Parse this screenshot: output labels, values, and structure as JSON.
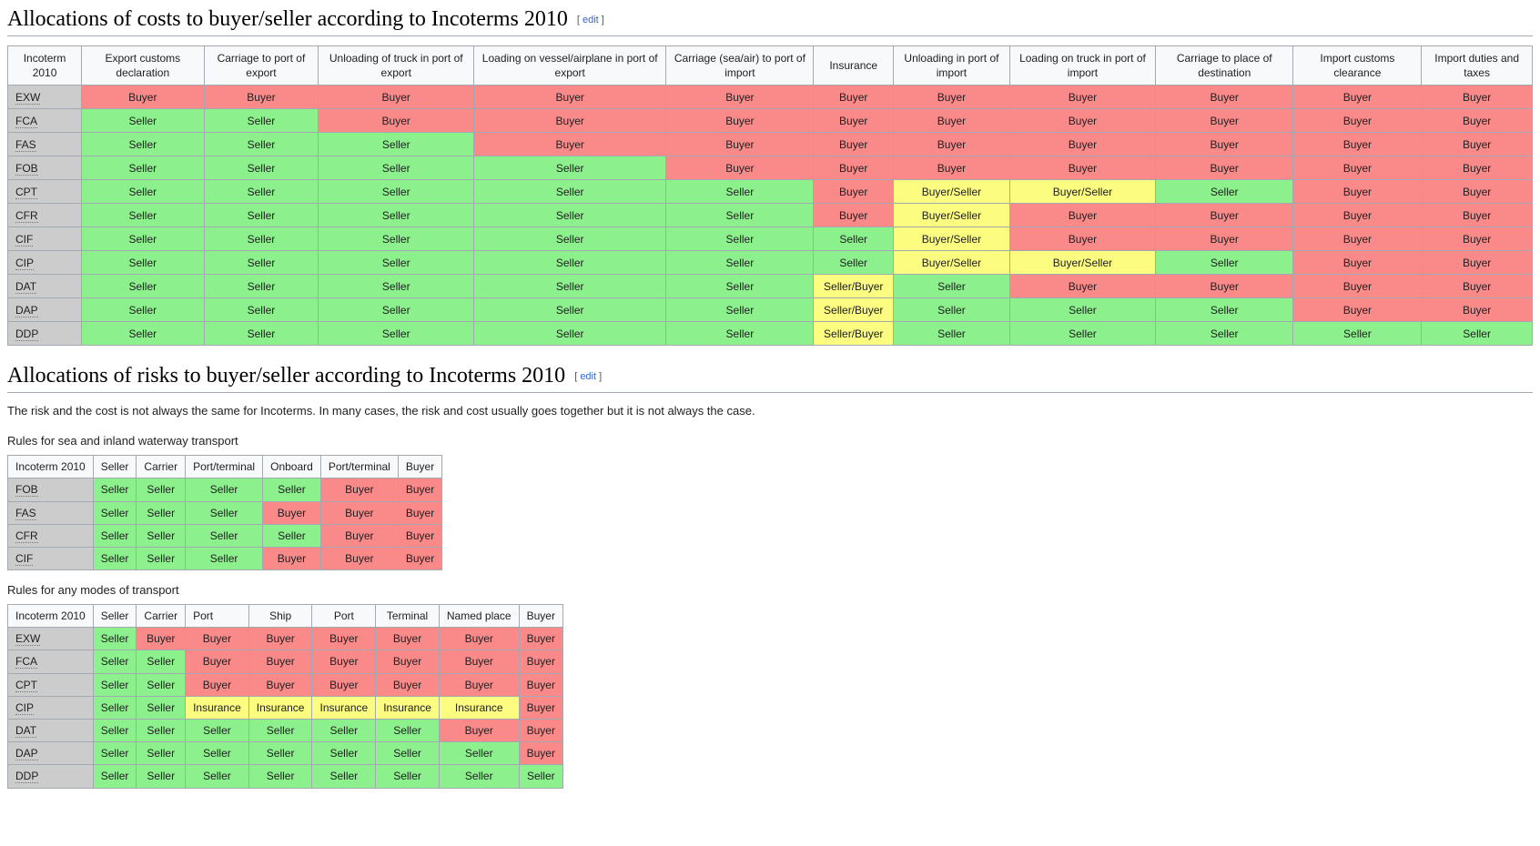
{
  "costs_section": {
    "heading": "Allocations of costs to buyer/seller according to Incoterms 2010",
    "edit_label": "edit",
    "bracket_open": "[",
    "bracket_close": "]",
    "table": {
      "headers": [
        "Incoterm 2010",
        "Export customs declaration",
        "Carriage to port of export",
        "Unloading of truck in port of export",
        "Loading on vessel/airplane in port of export",
        "Carriage (sea/air) to port of import",
        "Insurance",
        "Unloading in port of import",
        "Loading on truck in port of import",
        "Carriage to place of destination",
        "Import customs clearance",
        "Import duties and taxes"
      ],
      "rows": [
        {
          "term": "EXW",
          "cells": [
            "Buyer",
            "Buyer",
            "Buyer",
            "Buyer",
            "Buyer",
            "Buyer",
            "Buyer",
            "Buyer",
            "Buyer",
            "Buyer",
            "Buyer"
          ]
        },
        {
          "term": "FCA",
          "cells": [
            "Seller",
            "Seller",
            "Buyer",
            "Buyer",
            "Buyer",
            "Buyer",
            "Buyer",
            "Buyer",
            "Buyer",
            "Buyer",
            "Buyer"
          ]
        },
        {
          "term": "FAS",
          "cells": [
            "Seller",
            "Seller",
            "Seller",
            "Buyer",
            "Buyer",
            "Buyer",
            "Buyer",
            "Buyer",
            "Buyer",
            "Buyer",
            "Buyer"
          ]
        },
        {
          "term": "FOB",
          "cells": [
            "Seller",
            "Seller",
            "Seller",
            "Seller",
            "Buyer",
            "Buyer",
            "Buyer",
            "Buyer",
            "Buyer",
            "Buyer",
            "Buyer"
          ]
        },
        {
          "term": "CPT",
          "cells": [
            "Seller",
            "Seller",
            "Seller",
            "Seller",
            "Seller",
            "Buyer",
            "Buyer/Seller",
            "Buyer/Seller",
            "Seller",
            "Buyer",
            "Buyer"
          ]
        },
        {
          "term": "CFR",
          "cells": [
            "Seller",
            "Seller",
            "Seller",
            "Seller",
            "Seller",
            "Buyer",
            "Buyer/Seller",
            "Buyer",
            "Buyer",
            "Buyer",
            "Buyer"
          ]
        },
        {
          "term": "CIF",
          "cells": [
            "Seller",
            "Seller",
            "Seller",
            "Seller",
            "Seller",
            "Seller",
            "Buyer/Seller",
            "Buyer",
            "Buyer",
            "Buyer",
            "Buyer"
          ]
        },
        {
          "term": "CIP",
          "cells": [
            "Seller",
            "Seller",
            "Seller",
            "Seller",
            "Seller",
            "Seller",
            "Buyer/Seller",
            "Buyer/Seller",
            "Seller",
            "Buyer",
            "Buyer"
          ]
        },
        {
          "term": "DAT",
          "cells": [
            "Seller",
            "Seller",
            "Seller",
            "Seller",
            "Seller",
            "Seller/Buyer",
            "Seller",
            "Buyer",
            "Buyer",
            "Buyer",
            "Buyer"
          ]
        },
        {
          "term": "DAP",
          "cells": [
            "Seller",
            "Seller",
            "Seller",
            "Seller",
            "Seller",
            "Seller/Buyer",
            "Seller",
            "Seller",
            "Seller",
            "Buyer",
            "Buyer"
          ]
        },
        {
          "term": "DDP",
          "cells": [
            "Seller",
            "Seller",
            "Seller",
            "Seller",
            "Seller",
            "Seller/Buyer",
            "Seller",
            "Seller",
            "Seller",
            "Seller",
            "Seller"
          ]
        }
      ]
    }
  },
  "risks_section": {
    "heading": "Allocations of risks to buyer/seller according to Incoterms 2010",
    "edit_label": "edit",
    "bracket_open": "[",
    "bracket_close": "]",
    "intro": "The risk and the cost is not always the same for Incoterms. In many cases, the risk and cost usually goes together but it is not always the case.",
    "sea_label": "Rules for sea and inland waterway transport",
    "sea_table": {
      "headers": [
        "Incoterm 2010",
        "Seller",
        "Carrier",
        "Port/terminal",
        "Onboard",
        "Port/terminal",
        "Buyer"
      ],
      "rows": [
        {
          "term": "FOB",
          "cells": [
            "Seller",
            "Seller",
            "Seller",
            "Seller",
            "Buyer",
            "Buyer"
          ]
        },
        {
          "term": "FAS",
          "cells": [
            "Seller",
            "Seller",
            "Seller",
            "Buyer",
            "Buyer",
            "Buyer"
          ]
        },
        {
          "term": "CFR",
          "cells": [
            "Seller",
            "Seller",
            "Seller",
            "Seller",
            "Buyer",
            "Buyer"
          ]
        },
        {
          "term": "CIF",
          "cells": [
            "Seller",
            "Seller",
            "Seller",
            "Buyer",
            "Buyer",
            "Buyer"
          ]
        }
      ]
    },
    "any_label": "Rules for any modes of transport",
    "any_table": {
      "headers": [
        "Incoterm 2010",
        "Seller",
        "Carrier",
        "Port",
        "Ship",
        "Port",
        "Terminal",
        "Named place",
        "Buyer"
      ],
      "rows": [
        {
          "term": "EXW",
          "cells": [
            "Seller",
            "Buyer",
            "Buyer",
            "Buyer",
            "Buyer",
            "Buyer",
            "Buyer",
            "Buyer"
          ]
        },
        {
          "term": "FCA",
          "cells": [
            "Seller",
            "Seller",
            "Buyer",
            "Buyer",
            "Buyer",
            "Buyer",
            "Buyer",
            "Buyer"
          ]
        },
        {
          "term": "CPT",
          "cells": [
            "Seller",
            "Seller",
            "Buyer",
            "Buyer",
            "Buyer",
            "Buyer",
            "Buyer",
            "Buyer"
          ]
        },
        {
          "term": "CIP",
          "cells": [
            "Seller",
            "Seller",
            "Insurance",
            "Insurance",
            "Insurance",
            "Insurance",
            "Insurance",
            "Buyer"
          ]
        },
        {
          "term": "DAT",
          "cells": [
            "Seller",
            "Seller",
            "Seller",
            "Seller",
            "Seller",
            "Seller",
            "Buyer",
            "Buyer"
          ]
        },
        {
          "term": "DAP",
          "cells": [
            "Seller",
            "Seller",
            "Seller",
            "Seller",
            "Seller",
            "Seller",
            "Seller",
            "Buyer"
          ]
        },
        {
          "term": "DDP",
          "cells": [
            "Seller",
            "Seller",
            "Seller",
            "Seller",
            "Seller",
            "Seller",
            "Seller",
            "Seller"
          ]
        }
      ]
    }
  },
  "colors": {
    "buyer": "#fa8a8a",
    "seller": "#8cf08c",
    "mixed": "#fcfc80",
    "rowhead": "#cccccc",
    "link": "#3366cc",
    "border": "#a2a9b1"
  }
}
